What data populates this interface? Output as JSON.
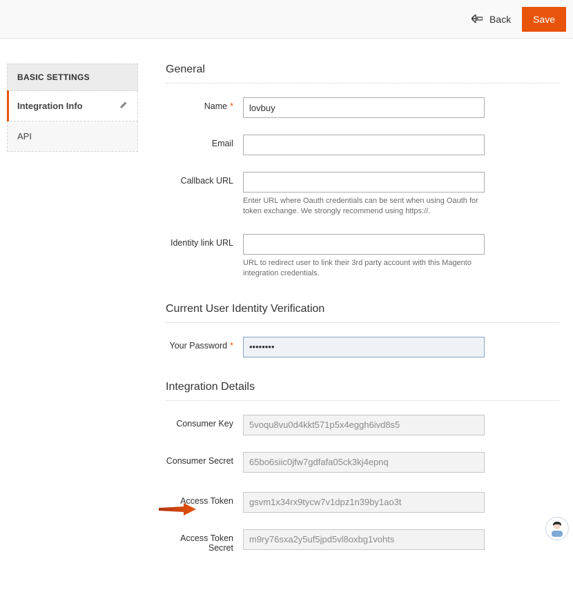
{
  "topbar": {
    "back_label": "Back",
    "save_label": "Save"
  },
  "sidebar": {
    "header": "BASIC SETTINGS",
    "items": [
      {
        "label": "Integration Info"
      },
      {
        "label": "API"
      }
    ]
  },
  "sections": {
    "general": {
      "title": "General",
      "name_label": "Name",
      "name_value": "lovbuy",
      "email_label": "Email",
      "email_value": "",
      "callback_label": "Callback URL",
      "callback_value": "",
      "callback_help": "Enter URL where Oauth credentials can be sent when using Oauth for token exchange. We strongly recommend using https://.",
      "identity_label": "Identity link URL",
      "identity_value": "",
      "identity_help": "URL to redirect user to link their 3rd party account with this Magento integration credentials."
    },
    "verify": {
      "title": "Current User Identity Verification",
      "password_label": "Your Password",
      "password_value": "••••••••"
    },
    "details": {
      "title": "Integration Details",
      "consumer_key_label": "Consumer Key",
      "consumer_key_value": "5voqu8vu0d4kkt571p5x4eggh6ivd8s5",
      "consumer_secret_label": "Consumer Secret",
      "consumer_secret_value": "65bo6siic0jfw7gdfafa05ck3kj4epnq",
      "access_token_label": "Access Token",
      "access_token_value": "gsvm1x34rx9tycw7v1dpz1n39by1ao3t",
      "access_token_secret_label": "Access Token Secret",
      "access_token_secret_value": "m9ry76sxa2y5uf5jpd5vl8oxbg1vohts"
    }
  }
}
